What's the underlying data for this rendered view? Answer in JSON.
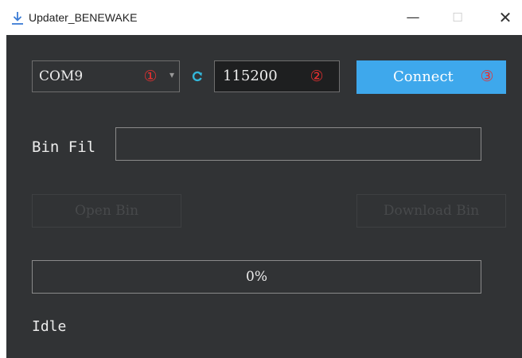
{
  "window": {
    "title": "Updater_BENEWAKE",
    "icon": "download-arrow-icon",
    "controls": {
      "minimize": "—",
      "maximize": "☐",
      "close": "✕"
    }
  },
  "port": {
    "selected": "COM9",
    "marker": "①",
    "dropdown_glyph": "▾"
  },
  "baud": {
    "value": "115200",
    "marker": "②"
  },
  "connect": {
    "label": "Connect",
    "marker": "③"
  },
  "bin": {
    "label": "Bin Fil",
    "value": ""
  },
  "buttons": {
    "open_bin": "Open Bin",
    "download_bin": "Download Bin"
  },
  "progress": {
    "percent": 0,
    "label": "0%"
  },
  "status": "Idle",
  "colors": {
    "accent": "#3ea8ec",
    "marker": "#e83030",
    "background": "#313335"
  }
}
